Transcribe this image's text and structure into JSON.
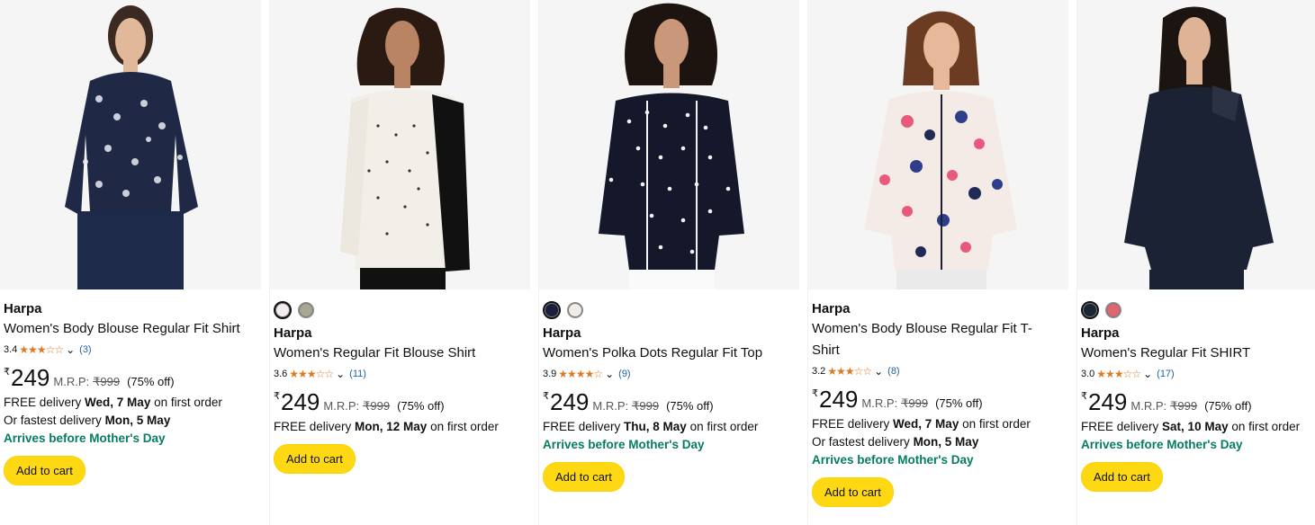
{
  "products": [
    {
      "brand": "Harpa",
      "title": "Women's Body Blouse Regular Fit Shirt",
      "rating": "3.4",
      "stars": "★★★☆☆",
      "reviews": "(3)",
      "currency": "₹",
      "price": "249",
      "mrp_label": "M.R.P:",
      "mrp": "₹999",
      "discount": "(75% off)",
      "delivery_prefix": "FREE delivery",
      "delivery_date": "Wed, 7 May",
      "delivery_suffix": "on first order",
      "fastest_prefix": "Or fastest delivery",
      "fastest_date": "Mon, 5 May",
      "promo": "Arrives before Mother's Day",
      "button": "Add to cart"
    },
    {
      "swatches": [
        "#f3eded",
        "#a9a692"
      ],
      "brand": "Harpa",
      "title": "Women's Regular Fit Blouse Shirt",
      "rating": "3.6",
      "stars": "★★★☆☆",
      "reviews": "(11)",
      "currency": "₹",
      "price": "249",
      "mrp_label": "M.R.P:",
      "mrp": "₹999",
      "discount": "(75% off)",
      "delivery_prefix": "FREE delivery",
      "delivery_date": "Mon, 12 May",
      "delivery_suffix": "on first order",
      "button": "Add to cart"
    },
    {
      "swatches": [
        "#1c1f3b",
        "#f2ece8"
      ],
      "brand": "Harpa",
      "title": "Women's Polka Dots Regular Fit Top",
      "rating": "3.9",
      "stars": "★★★★☆",
      "reviews": "(9)",
      "currency": "₹",
      "price": "249",
      "mrp_label": "M.R.P:",
      "mrp": "₹999",
      "discount": "(75% off)",
      "delivery_prefix": "FREE delivery",
      "delivery_date": "Thu, 8 May",
      "delivery_suffix": "on first order",
      "promo": "Arrives before Mother's Day",
      "button": "Add to cart"
    },
    {
      "brand": "Harpa",
      "title_line1": "Women's Body Blouse Regular Fit T-",
      "title_line2": "Shirt",
      "rating": "3.2",
      "stars": "★★★☆☆",
      "reviews": "(8)",
      "currency": "₹",
      "price": "249",
      "mrp_label": "M.R.P:",
      "mrp": "₹999",
      "discount": "(75% off)",
      "delivery_prefix": "FREE delivery",
      "delivery_date": "Wed, 7 May",
      "delivery_suffix": "on first order",
      "fastest_prefix": "Or fastest delivery",
      "fastest_date": "Mon, 5 May",
      "promo": "Arrives before Mother's Day",
      "button": "Add to cart"
    },
    {
      "swatches": [
        "#1a2433",
        "#e06570"
      ],
      "brand": "Harpa",
      "title": "Women's Regular Fit SHIRT",
      "rating": "3.0",
      "stars": "★★★☆☆",
      "reviews": "(17)",
      "currency": "₹",
      "price": "249",
      "mrp_label": "M.R.P:",
      "mrp": "₹999",
      "discount": "(75% off)",
      "delivery_prefix": "FREE delivery",
      "delivery_date": "Sat, 10 May",
      "delivery_suffix": "on first order",
      "promo": "Arrives before Mother's Day",
      "button": "Add to cart"
    }
  ],
  "colors": {
    "accent_button": "#ffd814",
    "star": "#de7921",
    "link": "#2162a1",
    "promo_green": "#067d62"
  }
}
